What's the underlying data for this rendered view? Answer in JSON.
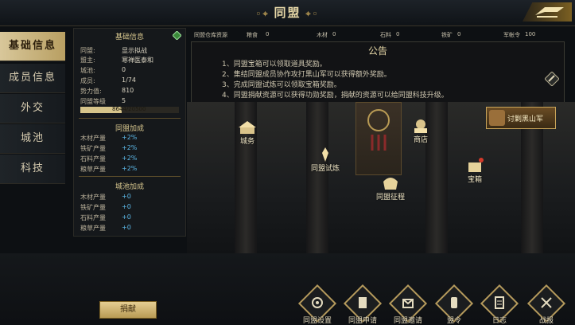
{
  "header": {
    "title": "同盟"
  },
  "tabs": [
    {
      "label": "基础信息",
      "active": true
    },
    {
      "label": "成员信息",
      "active": false
    },
    {
      "label": "外交",
      "active": false
    },
    {
      "label": "城池",
      "active": false
    },
    {
      "label": "科技",
      "active": false
    }
  ],
  "basic": {
    "title": "基础信息",
    "rows": [
      {
        "k": "同盟:",
        "v": "显示拟战"
      },
      {
        "k": "盟主:",
        "v": "寒禅医泰和"
      },
      {
        "k": "城池:",
        "v": "0"
      },
      {
        "k": "成员:",
        "v": "1/74"
      },
      {
        "k": "势力值:",
        "v": "810"
      },
      {
        "k": "同盟等级",
        "v": "5"
      }
    ],
    "exp": "8644/20500",
    "exp_fraction": 0.42
  },
  "alliance_bonus": {
    "title": "同盟加成",
    "rows": [
      {
        "k": "木材产量",
        "v": "+2%"
      },
      {
        "k": "铁矿产量",
        "v": "+2%"
      },
      {
        "k": "石料产量",
        "v": "+2%"
      },
      {
        "k": "粮草产量",
        "v": "+2%"
      }
    ]
  },
  "city_bonus": {
    "title": "城池加成",
    "rows": [
      {
        "k": "木材产量",
        "v": "+0"
      },
      {
        "k": "铁矿产量",
        "v": "+0"
      },
      {
        "k": "石料产量",
        "v": "+0"
      },
      {
        "k": "粮草产量",
        "v": "+0"
      }
    ]
  },
  "resources": {
    "label": "同盟仓库资源",
    "items": [
      {
        "k": "粮食",
        "v": "0"
      },
      {
        "k": "木材",
        "v": "0"
      },
      {
        "k": "石料",
        "v": "0"
      },
      {
        "k": "铁矿",
        "v": "0"
      },
      {
        "k": "军帐令",
        "v": "100"
      }
    ]
  },
  "notice": {
    "title": "公告",
    "lines": [
      "1、同盟宝箱可以领取道具奖励。",
      "2、集结同盟成员协作攻打黑山军可以获得额外奖励。",
      "3、完成同盟试炼可以领取宝箱奖励。",
      "4、同盟捐献资源可以获得功勋奖励，捐献的资源可以给同盟科技升级。"
    ]
  },
  "buildings": {
    "citywork": "城务",
    "shop": "商店",
    "trial": "同盟试炼",
    "expedition": "同盟征程",
    "chest": "宝箱",
    "heishan": "讨剿黑山军"
  },
  "donate_label": "捐献",
  "bottom_buttons": [
    {
      "label": "同盟设置",
      "icon": "settings-icon"
    },
    {
      "label": "同盟申请",
      "icon": "scroll-icon"
    },
    {
      "label": "同盟邀请",
      "icon": "invite-icon"
    },
    {
      "label": "盟令",
      "icon": "token-icon"
    },
    {
      "label": "日志",
      "icon": "log-icon"
    },
    {
      "label": "战报",
      "icon": "battle-report-icon"
    }
  ],
  "colors": {
    "accent": "#c9a55a",
    "bonus": "#5cb8e8",
    "active_tab": "#d8c79a"
  }
}
